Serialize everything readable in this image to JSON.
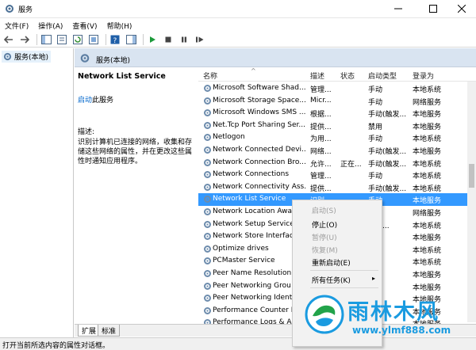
{
  "window": {
    "title": "服务"
  },
  "menubar": [
    {
      "label": "文件(F)"
    },
    {
      "label": "操作(A)"
    },
    {
      "label": "查看(V)"
    },
    {
      "label": "帮助(H)"
    }
  ],
  "tree": {
    "item": "服务(本地)"
  },
  "panel": {
    "header": "服务(本地)"
  },
  "detail": {
    "service_name": "Network List Service",
    "start_link": "启动",
    "start_suffix": "此服务",
    "desc_label": "描述:",
    "desc_text": "识别计算机已连接的网络，收集和存储这些网络的属性，并在更改这些属性时通知应用程序。"
  },
  "columns": [
    "名称",
    "描述",
    "状态",
    "启动类型",
    "登录为"
  ],
  "rows": [
    {
      "name": "Microsoft Software Shad...",
      "desc": "管理...",
      "status": "",
      "startup": "手动",
      "logon": "本地系统"
    },
    {
      "name": "Microsoft Storage Space...",
      "desc": "Micr...",
      "status": "",
      "startup": "手动",
      "logon": "网络服务"
    },
    {
      "name": "Microsoft Windows SMS ...",
      "desc": "根据...",
      "status": "",
      "startup": "手动(触发...",
      "logon": "本地服务"
    },
    {
      "name": "Net.Tcp Port Sharing Ser...",
      "desc": "提供...",
      "status": "",
      "startup": "禁用",
      "logon": "本地服务"
    },
    {
      "name": "Netlogon",
      "desc": "为用...",
      "status": "",
      "startup": "手动",
      "logon": "本地系统"
    },
    {
      "name": "Network Connected Devi...",
      "desc": "网络...",
      "status": "",
      "startup": "手动(触发...",
      "logon": "本地服务"
    },
    {
      "name": "Network Connection Bro...",
      "desc": "允许...",
      "status": "正在...",
      "startup": "手动(触发...",
      "logon": "本地系统"
    },
    {
      "name": "Network Connections",
      "desc": "管理...",
      "status": "",
      "startup": "手动",
      "logon": "本地系统"
    },
    {
      "name": "Network Connectivity Ass...",
      "desc": "提供...",
      "status": "",
      "startup": "手动(触发...",
      "logon": "本地系统"
    },
    {
      "name": "Network List Service",
      "desc": "识别...",
      "status": "",
      "startup": "手动",
      "logon": "本地服务"
    },
    {
      "name": "Network Location Awa",
      "desc": "",
      "status": "",
      "startup": "",
      "logon": "网络服务"
    },
    {
      "name": "Network Setup Service",
      "desc": "",
      "status": "",
      "startup": "触发...",
      "logon": "本地系统"
    },
    {
      "name": "Network Store Interfac",
      "desc": "",
      "status": "",
      "startup": "",
      "logon": "本地服务"
    },
    {
      "name": "Optimize drives",
      "desc": "",
      "status": "",
      "startup": "",
      "logon": "本地系统"
    },
    {
      "name": "PCMaster Service",
      "desc": "",
      "status": "",
      "startup": "",
      "logon": "本地系统"
    },
    {
      "name": "Peer Name Resolution",
      "desc": "",
      "status": "",
      "startup": "",
      "logon": "本地服务"
    },
    {
      "name": "Peer Networking Grou",
      "desc": "",
      "status": "",
      "startup": "",
      "logon": "本地服务"
    },
    {
      "name": "Peer Networking Ident",
      "desc": "",
      "status": "",
      "startup": "",
      "logon": "本地服务"
    },
    {
      "name": "Performance Counter D",
      "desc": "",
      "status": "",
      "startup": "",
      "logon": "本地服务"
    },
    {
      "name": "Performance Logs & Al",
      "desc": "",
      "status": "",
      "startup": "",
      "logon": "本地服务"
    }
  ],
  "context_menu": {
    "start": "启动(S)",
    "stop": "停止(O)",
    "pause": "暂停(U)",
    "resume": "恢复(M)",
    "restart": "重新启动(E)",
    "all_tasks": "所有任务(K)"
  },
  "tabs": {
    "extended": "扩展",
    "standard": "标准"
  },
  "status_text": "打开当前所选内容的属性对话框。",
  "watermark": {
    "text": "雨林木风",
    "url": "www.ylmf888.com"
  },
  "colors": {
    "selection": "#3399ff",
    "header": "#d9e4f1",
    "link": "#0066cc",
    "watermark": "#1a9be0"
  }
}
